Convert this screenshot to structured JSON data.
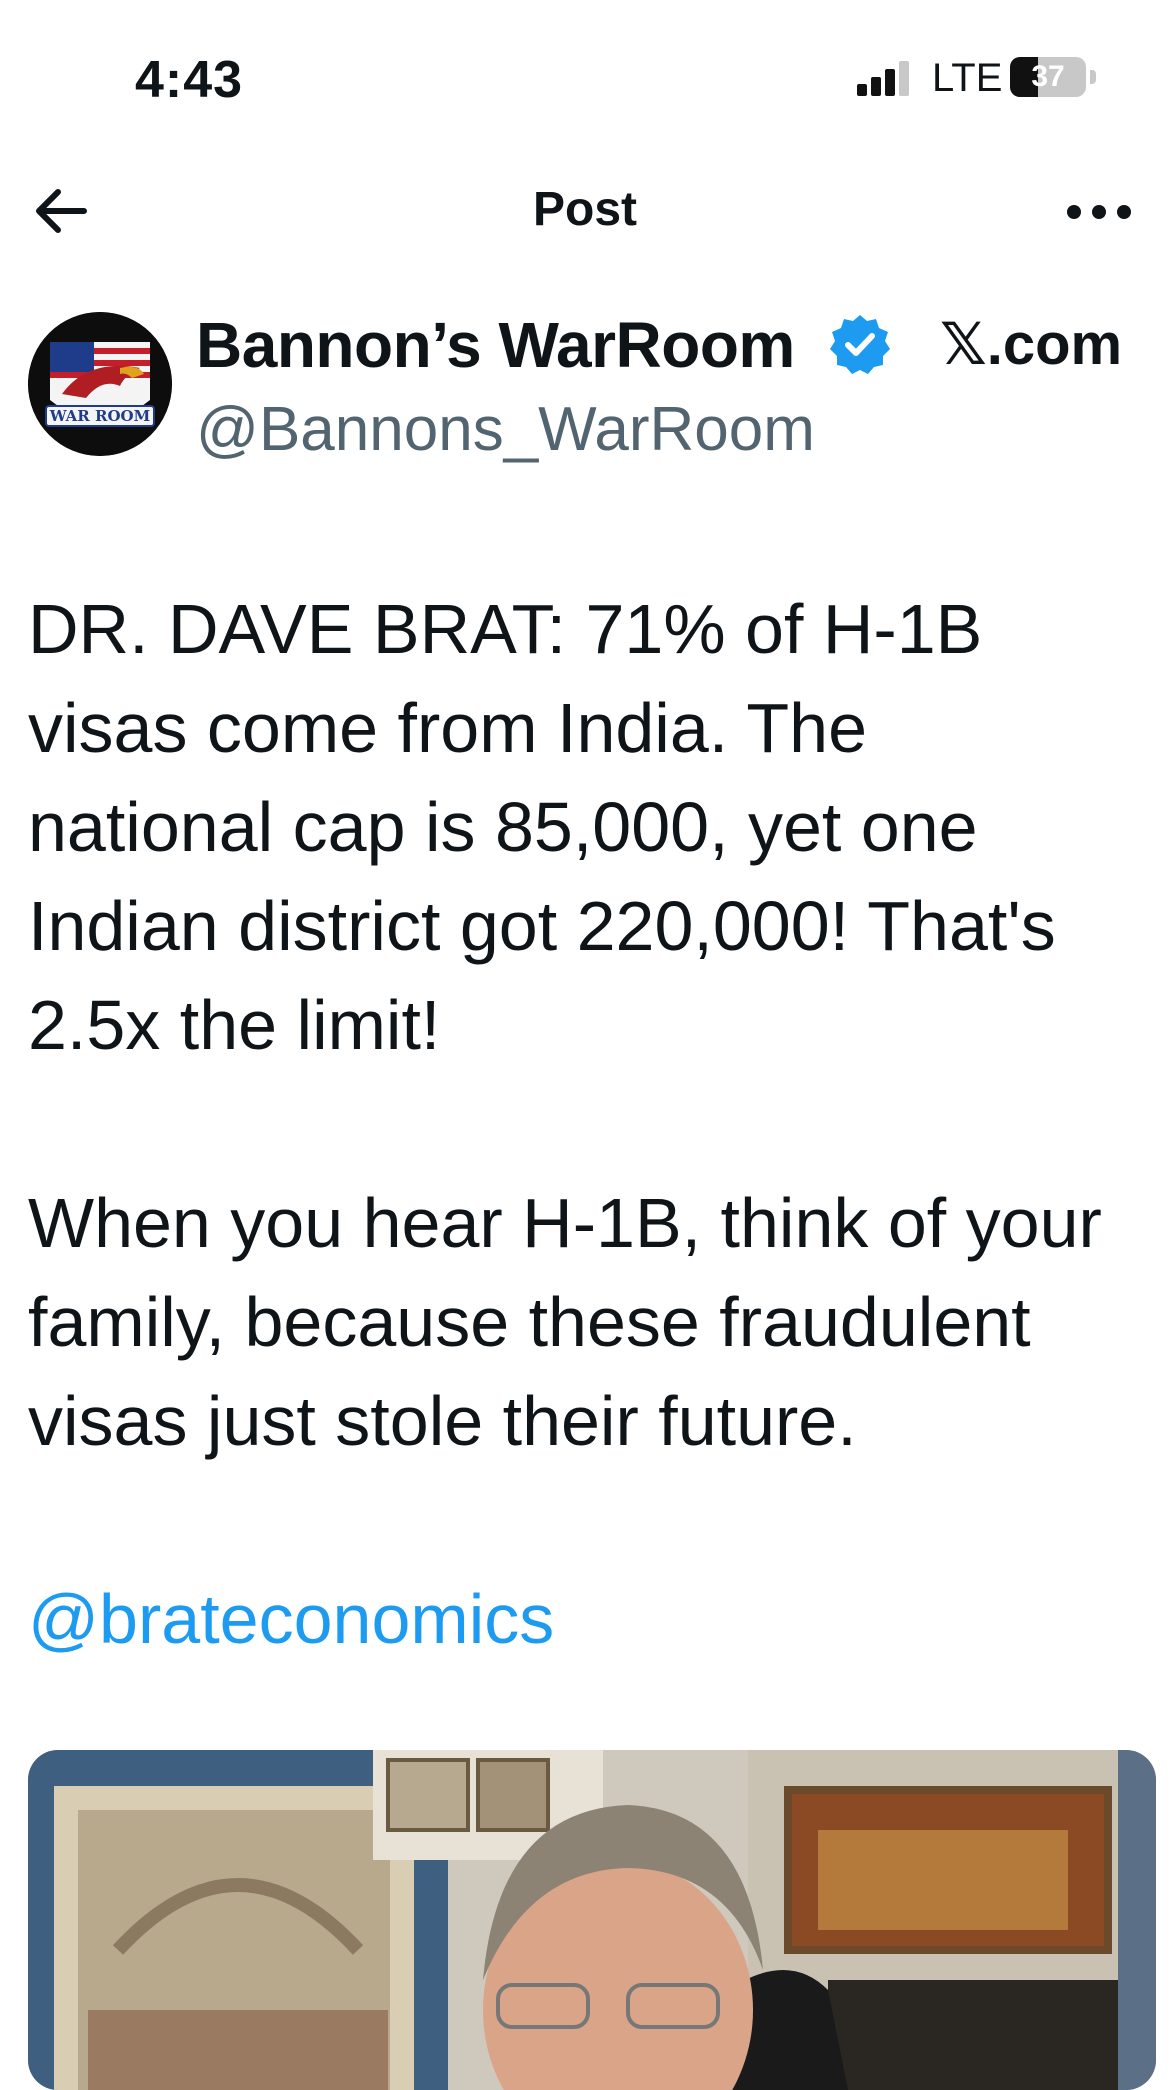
{
  "status_bar": {
    "time": "4:43",
    "network": "LTE",
    "battery_level": "37",
    "battery_fraction": 0.37
  },
  "nav": {
    "back_icon": "arrow-left-icon",
    "title": "Post",
    "more_icon": "more-horizontal-icon"
  },
  "author": {
    "display_name": "Bannon’s WarRoom",
    "handle": "@Bannons_WarRoom",
    "verified_icon": "verified-badge-icon",
    "avatar_text": "WAR ROOM",
    "watermark": "𝕏.com"
  },
  "tweet": {
    "lines_p1": [
      "DR. DAVE BRAT: 71% of H-1B",
      "visas come from India. The",
      "national cap is 85,000, yet one",
      "Indian district got 220,000! That's",
      "2.5x the limit!"
    ],
    "lines_p2": [
      "When you hear H-1B, think of your",
      "family, because these fraudulent",
      "visas just stole their future."
    ],
    "mention": "@brateconomics"
  },
  "colors": {
    "text": "#0f1419",
    "secondary": "#536471",
    "link": "#1d9bf0",
    "verified": "#1d9bf0",
    "background": "#ffffff"
  }
}
